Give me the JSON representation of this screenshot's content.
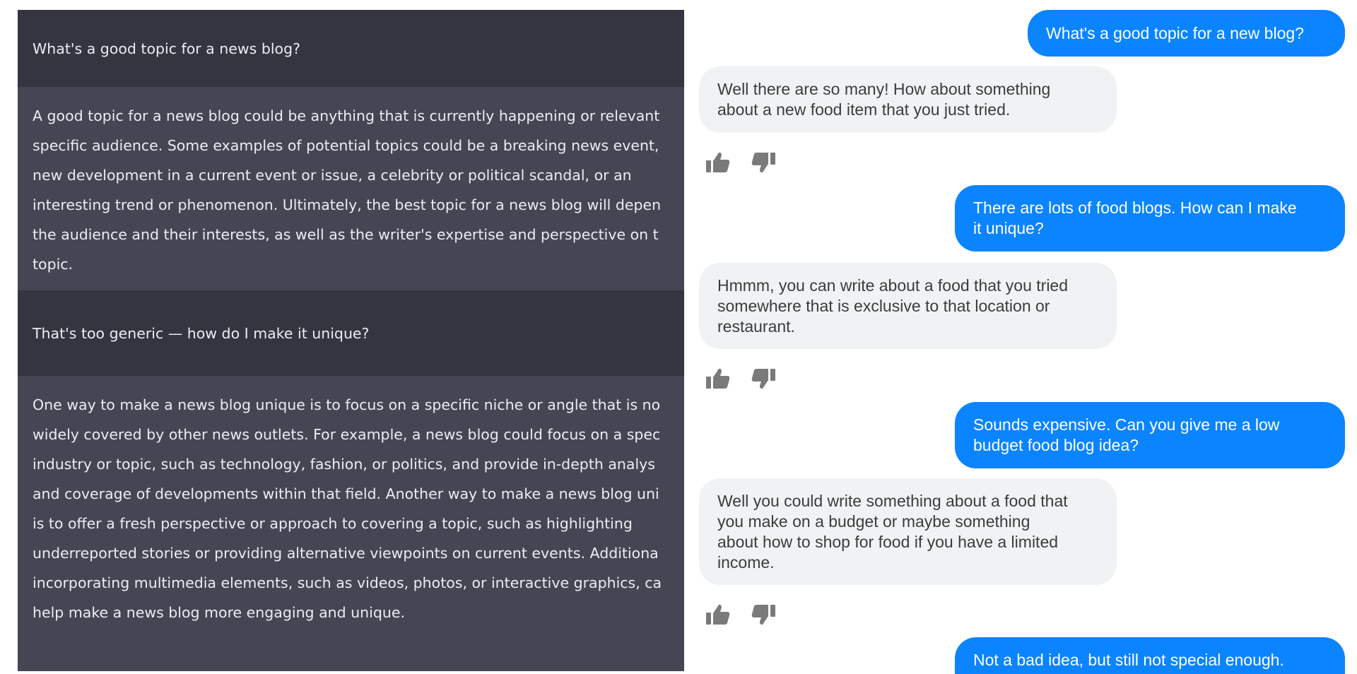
{
  "left_chat": {
    "messages": [
      {
        "role": "user",
        "text": "What's a good topic for a news blog?"
      },
      {
        "role": "assistant",
        "lines": [
          "A good topic for a news blog could be anything that is currently happening or relevant",
          "specific audience. Some examples of potential topics could be a breaking news event,",
          "new development in a current event or issue, a celebrity or political scandal, or an",
          "interesting trend or phenomenon. Ultimately, the best topic for a news blog will depen",
          "the audience and their interests, as well as the writer's expertise and perspective on t",
          "topic."
        ]
      },
      {
        "role": "user",
        "text": "That's too generic — how do I make it unique?"
      },
      {
        "role": "assistant",
        "lines": [
          "One way to make a news blog unique is to focus on a specific niche or angle that is no",
          "widely covered by other news outlets. For example, a news blog could focus on a spec",
          "industry or topic, such as technology, fashion, or politics, and provide in-depth analys",
          "and coverage of developments within that field. Another way to make a news blog uni",
          "is to offer a fresh perspective or approach to covering a topic, such as highlighting",
          "underreported stories or providing alternative viewpoints on current events. Additiona",
          "incorporating multimedia elements, such as videos, photos, or interactive graphics, ca",
          "help make a news blog more engaging and unique."
        ]
      }
    ],
    "colors": {
      "user_bg": "#343541",
      "assistant_bg": "#444654",
      "text": "#ececf1"
    }
  },
  "right_chat": {
    "messages": [
      {
        "role": "user",
        "lines": [
          "What's a good topic for a new blog?"
        ]
      },
      {
        "role": "bot",
        "lines": [
          "Well there are so many! How about something",
          "about a new food item that you just tried."
        ],
        "feedback": [
          "thumbs-up-icon",
          "thumbs-down-icon"
        ]
      },
      {
        "role": "user",
        "lines": [
          "There are lots of food blogs. How can I make",
          "it unique?"
        ]
      },
      {
        "role": "bot",
        "lines": [
          "Hmmm, you can write about a food that you tried",
          "somewhere that is exclusive to that location or",
          "restaurant."
        ],
        "feedback": [
          "thumbs-up-icon",
          "thumbs-down-icon"
        ]
      },
      {
        "role": "user",
        "lines": [
          "Sounds expensive. Can you give me a low",
          "budget food blog idea?"
        ]
      },
      {
        "role": "bot",
        "lines": [
          "Well you could write something about a food that",
          "you make on a budget or maybe something",
          "about how to shop for food if you have a limited",
          "income."
        ],
        "feedback": [
          "thumbs-up-icon",
          "thumbs-down-icon"
        ]
      },
      {
        "role": "user",
        "lines": [
          "Not a bad idea, but still not special enough."
        ]
      }
    ],
    "colors": {
      "user_bubble": "#0b84ff",
      "bot_bubble": "#f1f2f4",
      "icon": "#7a7a7a"
    }
  }
}
